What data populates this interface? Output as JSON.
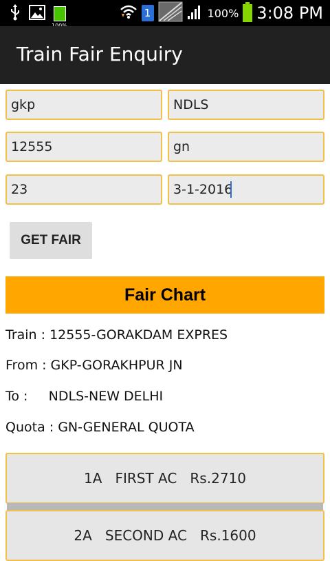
{
  "status_bar": {
    "battery_small_label": "100%",
    "notification_count": "1",
    "battery_percent": "100%",
    "time": "3:08 PM"
  },
  "action_bar": {
    "title": "Train Fair Enquiry"
  },
  "form": {
    "source": "gkp",
    "destination": "NDLS",
    "train_no": "12555",
    "quota": "gn",
    "age": "23",
    "date": "3-1-2016"
  },
  "get_fair_label": "GET FAIR",
  "fair_chart": {
    "title": "Fair Chart",
    "train": "Train : 12555-GORAKDAM EXPRES",
    "from": "From : GKP-GORAKHPUR JN",
    "to": "To :     NDLS-NEW DELHI",
    "quota": "Quota : GN-GENERAL QUOTA",
    "fares": [
      {
        "text": "1A   FIRST AC   Rs.2710"
      },
      {
        "text": "2A   SECOND AC   Rs.1600"
      }
    ]
  },
  "colors": {
    "accent": "#ffa600",
    "field_border": "#f0c04a",
    "action_bar": "#212121"
  }
}
